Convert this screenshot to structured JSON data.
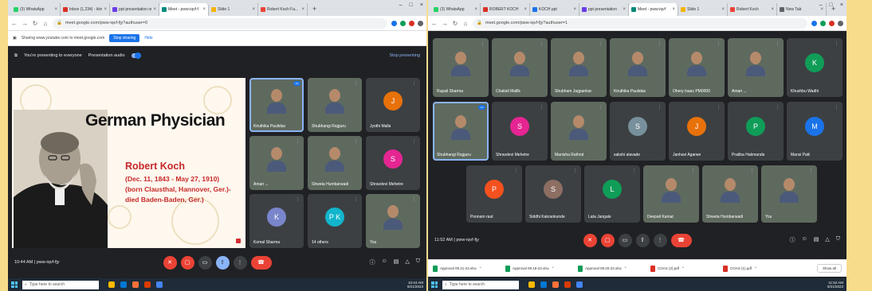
{
  "left": {
    "tabs": [
      {
        "label": "(3) WhatsApp",
        "color": "#25d366"
      },
      {
        "label": "Inbox (1,234) - kkmail",
        "color": "#d93025"
      },
      {
        "label": "ppt presentation on r",
        "color": "#6a3de8"
      },
      {
        "label": "Meet - pww-iqvf-f",
        "color": "#00897b",
        "active": true
      },
      {
        "label": "Slide 1",
        "color": "#f4b400"
      },
      {
        "label": "Robert Koch Fa...",
        "color": "#ea4335"
      }
    ],
    "url": "meet.google.com/pww-iqvf-fjy?authuser=0",
    "share_text": "Sharing www.youtube.com to meet.google.com",
    "stop_sharing": "Stop sharing",
    "hide": "Hide",
    "presenting_text": "You're presenting to everyone",
    "presentation_audio": "Presentation audio",
    "stop_presenting": "Stop presenting",
    "slide": {
      "title": "German Physician",
      "name": "Robert  Koch",
      "lines": [
        "(Dec. 11, 1843 - May 27, 1910)",
        "(born Clausthal, Hannover, Ger.)-",
        "died Baden-Baden, Ger.)"
      ]
    },
    "participants": [
      {
        "name": "Kiruthika Paulidas",
        "type": "photo"
      },
      {
        "name": "Shubhangi Rajguru",
        "type": "photo"
      },
      {
        "name": "Jyothi Malla",
        "initial": "J",
        "color": "#e8710a"
      },
      {
        "name": "Amari ...",
        "type": "photo"
      },
      {
        "name": "Shweta Humbarwadi",
        "type": "photo"
      },
      {
        "name": "Shravdevi Mehetre",
        "initial": "S",
        "color": "#e52592"
      },
      {
        "name": "Komal Sharma",
        "initial": "K",
        "color": "#7986cb"
      },
      {
        "name": "14 others",
        "initial": "P K",
        "color": "#12b5cb"
      },
      {
        "name": "You",
        "type": "photo"
      }
    ],
    "time": "10:44 AM  |  pww-iqvf-fjy"
  },
  "right": {
    "tabs": [
      {
        "label": "(3) WhatsApp",
        "color": "#25d366"
      },
      {
        "label": "ROBERT KOCH",
        "color": "#d93025"
      },
      {
        "label": "KOCH ppt",
        "color": "#1a73e8"
      },
      {
        "label": "ppt presentation",
        "color": "#6a3de8"
      },
      {
        "label": "Meet - pww-iqvf",
        "color": "#00897b",
        "active": true
      },
      {
        "label": "Slide 1",
        "color": "#f4b400"
      },
      {
        "label": "Robert Koch",
        "color": "#ea4335"
      },
      {
        "label": "New Tab",
        "color": "#5f6368"
      }
    ],
    "url": "meet.google.com/pww-iqvf-fjy?authuser=1",
    "participants": [
      {
        "name": "Rupali Sharma",
        "type": "photo"
      },
      {
        "name": "Chaitali Mallik",
        "type": "photo"
      },
      {
        "name": "Shubham Jagpankar",
        "type": "photo"
      },
      {
        "name": "Kiruthika Paulidas",
        "type": "photo"
      },
      {
        "name": "Ohery Isaac PM0000",
        "type": "photo"
      },
      {
        "name": "Amari ...",
        "type": "photo"
      },
      {
        "name": "Khushbu Wadhi",
        "initial": "K",
        "color": "#0f9d58"
      },
      {
        "name": "Shubhangi Rajguru",
        "type": "photo"
      },
      {
        "name": "Shravdevi Mehetre",
        "initial": "S",
        "color": "#e52592"
      },
      {
        "name": "Manisha Rathod",
        "type": "photo"
      },
      {
        "name": "sakshi alavade",
        "initial": "S",
        "color": "#78909c"
      },
      {
        "name": "Janhavi Agarwe",
        "initial": "J",
        "color": "#e8710a"
      },
      {
        "name": "Pratiba Hakmanda",
        "initial": "P",
        "color": "#0f9d58"
      },
      {
        "name": "Mansi Patil",
        "initial": "M",
        "color": "#1a73e8"
      },
      {
        "name": "Poonam raut",
        "initial": "P",
        "color": "#f4511e"
      },
      {
        "name": "Siddhi Kakrankunde",
        "initial": "S",
        "color": "#8d6e63"
      },
      {
        "name": "Lata Jangale",
        "initial": "L",
        "color": "#0f9d58"
      },
      {
        "name": "Deepali Kamat",
        "type": "photo"
      },
      {
        "name": "Shweta Humbarwadi",
        "type": "photo"
      },
      {
        "name": "You",
        "type": "photo"
      }
    ],
    "time": "11:52 AM  |  pww-iqvf-fjy",
    "downloads": [
      {
        "label": "Approval 09.21-23.xlsx",
        "color": "#0f9d58"
      },
      {
        "label": "Approval 09.18-23.xlsx",
        "color": "#0f9d58"
      },
      {
        "label": "Approval 09.20-23.xlsx",
        "color": "#0f9d58"
      },
      {
        "label": "COAS (2).pdf",
        "color": "#d93025"
      },
      {
        "label": "COAS (1).pdf",
        "color": "#d93025"
      }
    ],
    "show_all": "Show all"
  },
  "taskbar": {
    "search": "Type here to search",
    "left_time": "10:44 AM",
    "right_time": "11:52 AM",
    "date": "9/21/2023"
  }
}
